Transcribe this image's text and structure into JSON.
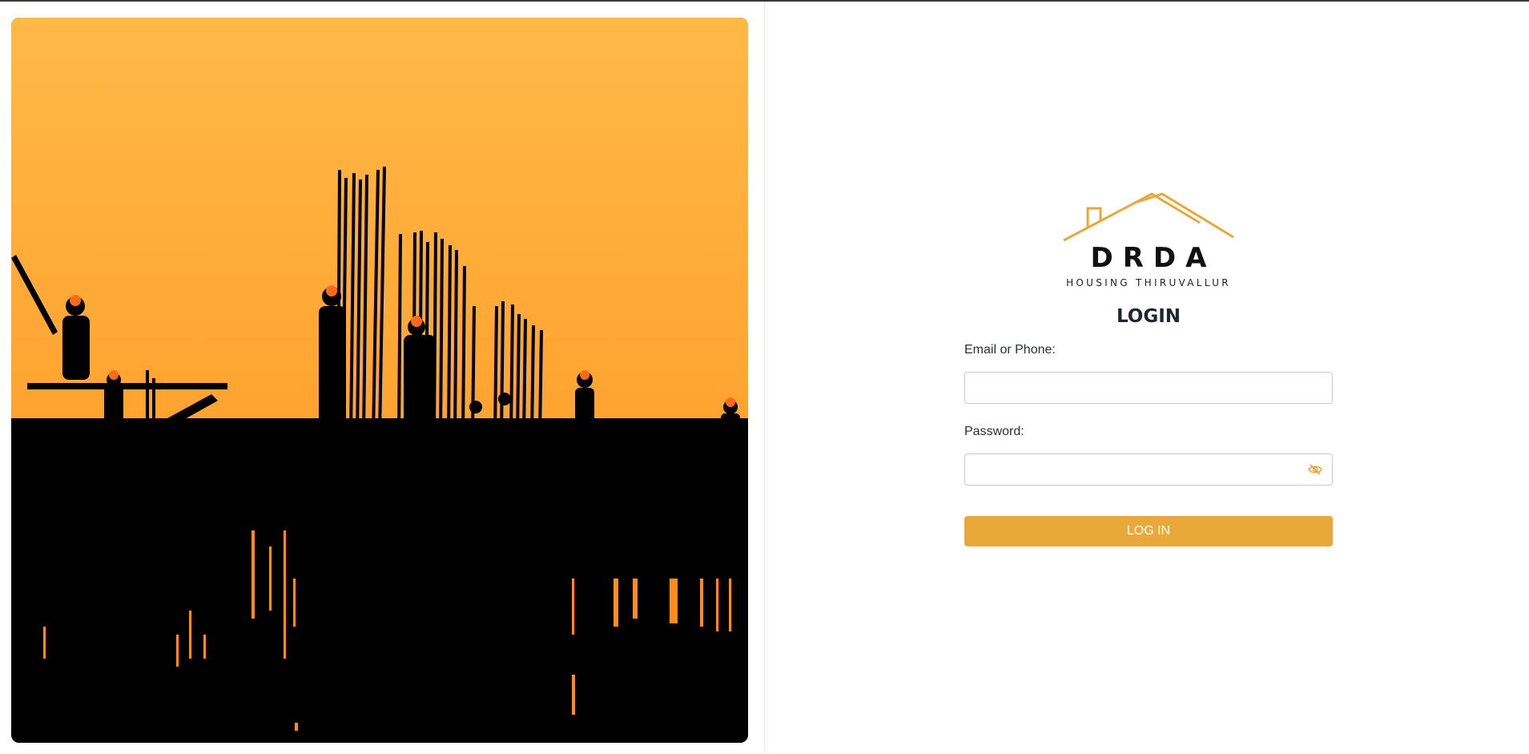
{
  "hero": {
    "image": "construction-workers-silhouette-sunset"
  },
  "brand": {
    "name": "DRDA",
    "tagline": "HOUSING THIRUVALLUR",
    "icon": "house-roof-icon",
    "accent_color": "#e8a93a"
  },
  "login": {
    "title": "LOGIN",
    "email_label": "Email or Phone:",
    "email_value": "",
    "email_placeholder": "",
    "password_label": "Password:",
    "password_value": "",
    "password_placeholder": "",
    "toggle_icon": "eye-slash-icon",
    "submit_label": "LOG IN"
  }
}
